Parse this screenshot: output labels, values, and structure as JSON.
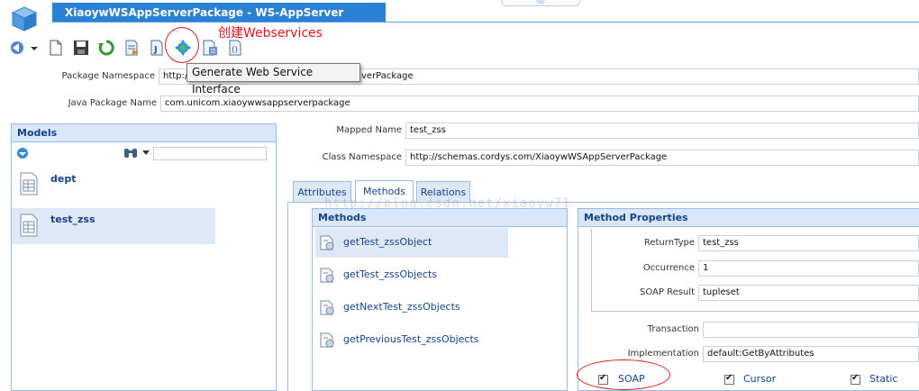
{
  "window": {
    "tab_title": "XiaoywWSAppServerPackage - WS-AppServer Package*"
  },
  "annotation": {
    "text": "创建Webservices"
  },
  "tooltip": {
    "text": "Generate Web Service Interface"
  },
  "package": {
    "namespace_label": "Package Namespace",
    "namespace_value_left": "http://",
    "namespace_value_right": "verPackage",
    "java_package_label": "Java Package Name",
    "java_package_value": "com.unicom.xiaoywwsappserverpackage"
  },
  "models": {
    "header": "Models",
    "items": [
      {
        "label": "dept"
      },
      {
        "label": "test_zss"
      }
    ]
  },
  "mapping": {
    "mapped_name_label": "Mapped Name",
    "mapped_name_value": "test_zss",
    "class_ns_label": "Class Namespace",
    "class_ns_value": "http://schemas.cordys.com/XiaoywWSAppServerPackage"
  },
  "tabs": [
    {
      "label": "Attributes"
    },
    {
      "label": "Methods"
    },
    {
      "label": "Relations"
    }
  ],
  "methods": {
    "header": "Methods",
    "items": [
      {
        "label": "getTest_zssObject"
      },
      {
        "label": "getTest_zssObjects"
      },
      {
        "label": "getNextTest_zssObjects"
      },
      {
        "label": "getPreviousTest_zssObjects"
      }
    ]
  },
  "properties": {
    "header": "Method Properties",
    "return_type_label": "ReturnType",
    "return_type_value": "test_zss",
    "occurrence_label": "Occurrence",
    "occurrence_value": "1",
    "soap_result_label": "SOAP Result",
    "soap_result_value": "tupleset",
    "transaction_label": "Transaction",
    "transaction_value": "",
    "implementation_label": "Implementation",
    "implementation_value": "default:GetByAttributes",
    "checks": [
      {
        "label": "SOAP",
        "checked": true
      },
      {
        "label": "Cursor",
        "checked": true
      },
      {
        "label": "Static",
        "checked": true
      }
    ]
  },
  "watermark": "http://blog.csdn.net/xiaoyw71",
  "colors": {
    "title_bar": "#2a80d2",
    "panel_header": "#d9e7f8",
    "panel_border": "#99bbe8",
    "selection": "#dfe8f6",
    "annotation": "#e0141a"
  }
}
